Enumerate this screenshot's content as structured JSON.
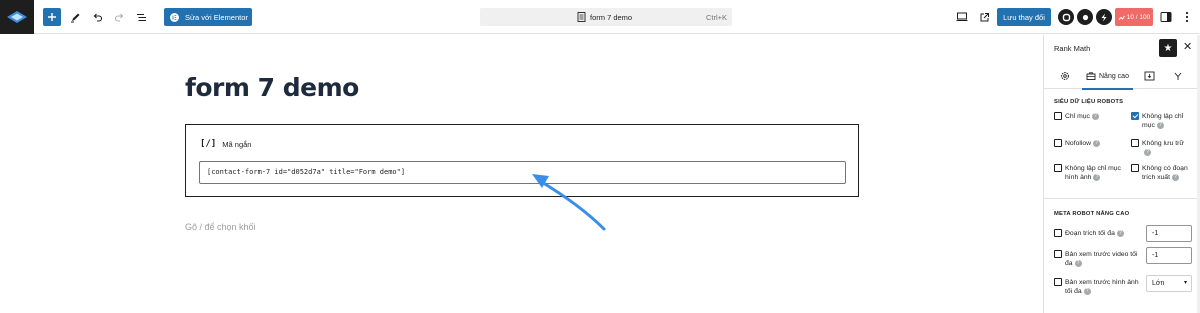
{
  "toolbar": {
    "elementor_label": "Sửa với Elementor",
    "doc_title": "form 7 demo",
    "shortcut": "Ctrl+K",
    "save_label": "Lưu thay đổi",
    "score": "10 / 100",
    "icons": [
      "wordpress-logo-icon",
      "plus-icon",
      "pen-icon",
      "undo-icon",
      "redo-icon",
      "list-view-icon",
      "desktop-icon",
      "external-link-icon",
      "rank-math-icon",
      "seo-icon",
      "lightning-icon",
      "sidebar-toggle-icon"
    ]
  },
  "canvas": {
    "post_title": "form 7 demo",
    "block": {
      "icon_text": "[/]",
      "label": "Mã ngắn",
      "shortcode": "[contact-form-7 id=\"d052d7a\" title=\"Form demo\"]"
    },
    "placeholder": "Gõ / để chọn khối"
  },
  "sidebar": {
    "title": "Rank Math",
    "tabs": [
      {
        "icon": "gear-icon",
        "label": ""
      },
      {
        "icon": "briefcase-icon",
        "label": "Nâng cao"
      },
      {
        "icon": "schema-icon",
        "label": ""
      },
      {
        "icon": "social-icon",
        "label": ""
      }
    ],
    "robots_section_title": "SIÊU DỮ LIỆU ROBOTS",
    "robots": [
      {
        "label": "Chỉ mục",
        "checked": false
      },
      {
        "label": "Không lập chỉ mục",
        "checked": true
      },
      {
        "label": "Nofollow",
        "checked": false
      },
      {
        "label": "Không lưu trữ",
        "checked": false
      },
      {
        "label": "Không lập chỉ mục hình ảnh",
        "checked": false
      },
      {
        "label": "Không có đoạn trích xuất",
        "checked": false
      }
    ],
    "advanced_section_title": "META ROBOT NÂNG CAO",
    "advanced": [
      {
        "label": "Đoạn trích tối đa",
        "value": "-1"
      },
      {
        "label": "Bản xem trước video tối đa",
        "value": "-1"
      },
      {
        "label": "Bản xem trước hình ảnh tối đa",
        "value": "Lớn"
      }
    ]
  },
  "colors": {
    "accent": "#2271b1",
    "score_badge": "#f06a6a",
    "arrow": "#3b8ee8",
    "title": "#1e2b3c"
  }
}
